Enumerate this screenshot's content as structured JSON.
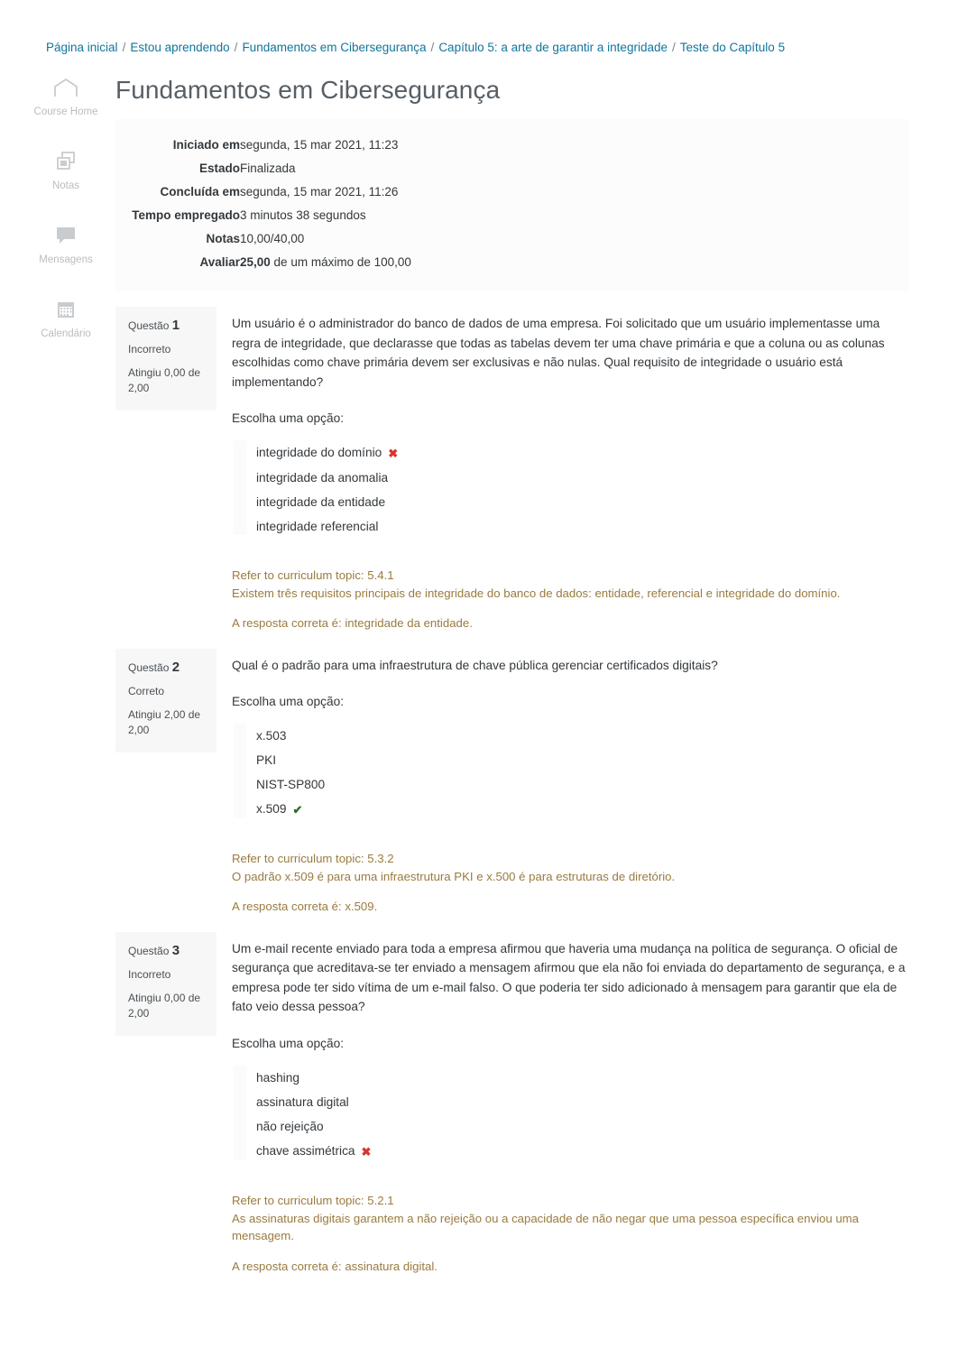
{
  "breadcrumb": {
    "separator": "/",
    "items": [
      {
        "label": "Página inicial"
      },
      {
        "label": "Estou aprendendo"
      },
      {
        "label": "Fundamentos em Cibersegurança"
      },
      {
        "label": "Capítulo 5: a arte de garantir a integridade"
      },
      {
        "label": "Teste do Capítulo 5"
      }
    ]
  },
  "sidebar": {
    "items": [
      {
        "icon": "home-icon",
        "label": "Course Home"
      },
      {
        "icon": "grades-icon",
        "label": "Notas"
      },
      {
        "icon": "messages-icon",
        "label": "Mensagens"
      },
      {
        "icon": "calendar-icon",
        "label": "Calendário"
      }
    ]
  },
  "page": {
    "title": "Fundamentos em Cibersegurança"
  },
  "summary": {
    "rows": [
      {
        "label": "Iniciado em",
        "value": "segunda, 15 mar 2021, 11:23"
      },
      {
        "label": "Estado",
        "value": "Finalizada"
      },
      {
        "label": "Concluída em",
        "value": "segunda, 15 mar 2021, 11:26"
      },
      {
        "label": "Tempo empregado",
        "value": "3 minutos 38 segundos"
      },
      {
        "label": "Notas",
        "value": "10,00/40,00"
      }
    ],
    "grade_label": "Avaliar",
    "grade_value": "25,00",
    "grade_suffix": " de um máximo de 100,00"
  },
  "questions": [
    {
      "number_label": "Questão",
      "number": "1",
      "state": "Incorreto",
      "mark": "Atingiu 0,00 de 2,00",
      "text": "Um usuário é o administrador do banco de dados de uma empresa. Foi solicitado que um usuário implementasse uma regra de integridade, que declarasse que todas as tabelas devem ter uma chave primária e que a coluna ou as colunas escolhidas como chave primária devem ser exclusivas e não nulas. Qual requisito de integridade o usuário está implementando?",
      "prompt": "Escolha uma opção:",
      "options": [
        {
          "label": "integridade do domínio",
          "mark": "wrong",
          "glyph": "✖"
        },
        {
          "label": "integridade da anomalia",
          "mark": "none",
          "glyph": ""
        },
        {
          "label": "integridade da entidade",
          "mark": "none",
          "glyph": ""
        },
        {
          "label": "integridade referencial",
          "mark": "none",
          "glyph": ""
        }
      ],
      "feedback_topic": "Refer to curriculum topic: 5.4.1",
      "feedback_text": "Existem três requisitos principais de integridade do banco de dados: entidade, referencial e integridade do domínio.",
      "feedback_correct": "A resposta correta é: integridade da entidade."
    },
    {
      "number_label": "Questão",
      "number": "2",
      "state": "Correto",
      "mark": "Atingiu 2,00 de 2,00",
      "text": "Qual é o padrão para uma infraestrutura de chave pública gerenciar certificados digitais?",
      "prompt": "Escolha uma opção:",
      "options": [
        {
          "label": "x.503",
          "mark": "none",
          "glyph": ""
        },
        {
          "label": "PKI",
          "mark": "none",
          "glyph": ""
        },
        {
          "label": "NIST-SP800",
          "mark": "none",
          "glyph": ""
        },
        {
          "label": "x.509",
          "mark": "right",
          "glyph": "✔"
        }
      ],
      "feedback_topic": "Refer to curriculum topic: 5.3.2",
      "feedback_text": "O padrão x.509 é para uma infraestrutura PKI e x.500 é para estruturas de diretório.",
      "feedback_correct": "A resposta correta é: x.509."
    },
    {
      "number_label": "Questão",
      "number": "3",
      "state": "Incorreto",
      "mark": "Atingiu 0,00 de 2,00",
      "text": "Um e-mail recente enviado para toda a empresa afirmou que haveria uma mudança na política de segurança. O oficial de segurança que acreditava-se ter enviado a mensagem afirmou que ela não foi enviada do departamento de segurança, e a empresa pode ter sido vítima de um e-mail falso. O que poderia ter sido adicionado à mensagem para garantir que ela de fato veio dessa pessoa?",
      "prompt": "Escolha uma opção:",
      "options": [
        {
          "label": "hashing",
          "mark": "none",
          "glyph": ""
        },
        {
          "label": "assinatura digital",
          "mark": "none",
          "glyph": ""
        },
        {
          "label": "não rejeição",
          "mark": "none",
          "glyph": ""
        },
        {
          "label": "chave assimétrica",
          "mark": "wrong",
          "glyph": "✖"
        }
      ],
      "feedback_topic": "Refer to curriculum topic: 5.2.1",
      "feedback_text": "As assinaturas digitais garantem a não rejeição ou a capacidade de não negar que uma pessoa específica enviou uma mensagem.",
      "feedback_correct": "A resposta correta é: assinatura digital."
    }
  ],
  "colors": {
    "link": "#12759c",
    "feedback": "#9a7b3f",
    "wrong": "#d9342b",
    "right": "#2f6e33",
    "info_bg": "#f7f7f7"
  }
}
